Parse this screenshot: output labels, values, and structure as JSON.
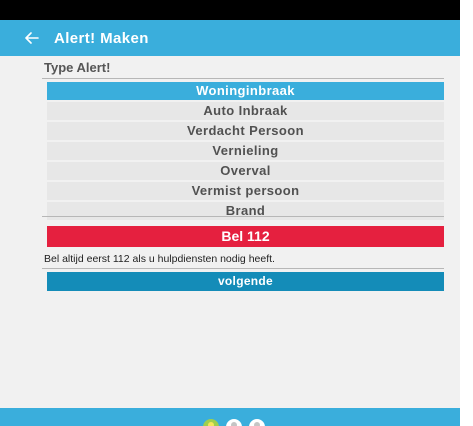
{
  "app_bar": {
    "title": "Alert! Maken",
    "back_icon": "arrow-left-icon",
    "color": "#3aaedc"
  },
  "section": {
    "title": "Type Alert!"
  },
  "alert_types": [
    {
      "label": "Woninginbraak",
      "selected": true
    },
    {
      "label": "Auto Inbraak",
      "selected": false
    },
    {
      "label": "Verdacht Persoon",
      "selected": false
    },
    {
      "label": "Vernieling",
      "selected": false
    },
    {
      "label": "Overval",
      "selected": false
    },
    {
      "label": "Vermist persoon",
      "selected": false
    },
    {
      "label": "Brand",
      "selected": false
    }
  ],
  "call_button": {
    "label": "Bel 112",
    "color": "#e5203f"
  },
  "info_text": "Bel altijd eerst 112 als u hulpdiensten nodig heeft.",
  "next_button": {
    "label": "volgende",
    "color": "#148cb8"
  },
  "pager": {
    "active_index": 0,
    "count": 3
  }
}
